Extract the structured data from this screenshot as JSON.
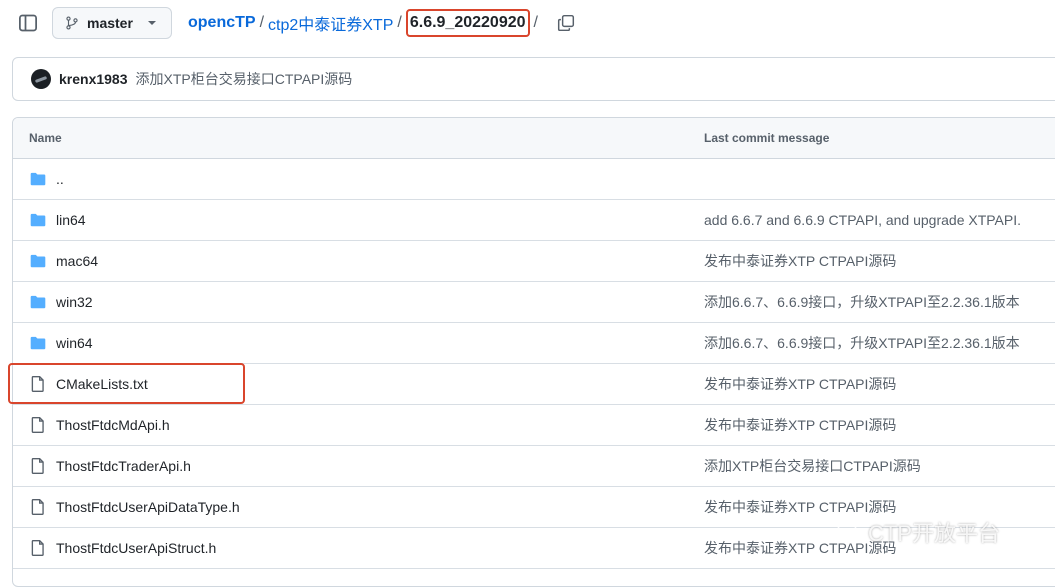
{
  "toolbar": {
    "branch_label": "master"
  },
  "breadcrumb": {
    "root": "opencTP_ROOT",
    "items": [
      "opencTP",
      "ctp2中泰证券XTP"
    ],
    "current": "6.6.9_20220920",
    "separator": "/"
  },
  "commit": {
    "author": "krenx1983",
    "message": "添加XTP柜台交易接口CTPAPI源码"
  },
  "table": {
    "headers": {
      "name": "Name",
      "message": "Last commit message"
    },
    "rows": [
      {
        "type": "folder",
        "name": "..",
        "message": ""
      },
      {
        "type": "folder",
        "name": "lin64",
        "message": "add 6.6.7 and 6.6.9 CTPAPI, and upgrade XTPAPI."
      },
      {
        "type": "folder",
        "name": "mac64",
        "message": "发布中泰证券XTP CTPAPI源码"
      },
      {
        "type": "folder",
        "name": "win32",
        "message": "添加6.6.7、6.6.9接口，升级XTPAPI至2.2.36.1版本"
      },
      {
        "type": "folder",
        "name": "win64",
        "message": "添加6.6.7、6.6.9接口，升级XTPAPI至2.2.36.1版本"
      },
      {
        "type": "file",
        "name": "CMakeLists.txt",
        "message": "发布中泰证券XTP CTPAPI源码"
      },
      {
        "type": "file",
        "name": "ThostFtdcMdApi.h",
        "message": "发布中泰证券XTP CTPAPI源码"
      },
      {
        "type": "file",
        "name": "ThostFtdcTraderApi.h",
        "message": "添加XTP柜台交易接口CTPAPI源码"
      },
      {
        "type": "file",
        "name": "ThostFtdcUserApiDataType.h",
        "message": "发布中泰证券XTP CTPAPI源码"
      },
      {
        "type": "file",
        "name": "ThostFtdcUserApiStruct.h",
        "message": "发布中泰证券XTP CTPAPI源码"
      }
    ]
  },
  "watermark": {
    "text": "CTP开放平台"
  },
  "colors": {
    "link": "#0969da",
    "folder": "#54aeff",
    "highlight": "#d9452c"
  }
}
